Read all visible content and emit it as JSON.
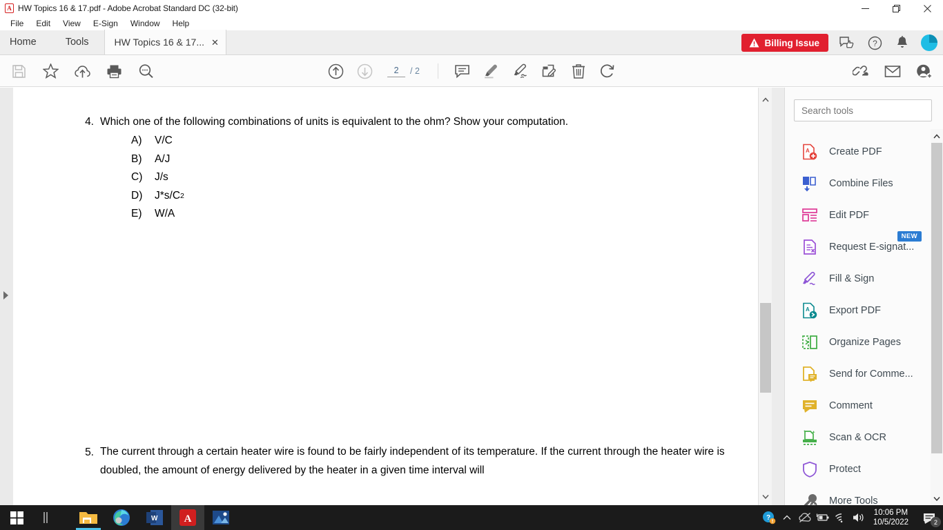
{
  "window": {
    "title": "HW Topics 16 & 17.pdf - Adobe Acrobat Standard DC (32-bit)",
    "app_icon": "acrobat-icon",
    "minimize": "—",
    "restore": "❐",
    "close": "✕"
  },
  "menu": {
    "items": [
      "File",
      "Edit",
      "View",
      "E-Sign",
      "Window",
      "Help"
    ]
  },
  "tabs": {
    "home": "Home",
    "tools": "Tools",
    "document": "HW Topics 16 & 17...",
    "close_glyph": "✕",
    "billing": {
      "label": "Billing Issue",
      "color": "#e1202f",
      "icon": "warning-triangle-icon"
    },
    "right_icons": [
      "feedback-icon",
      "help-icon",
      "bell-icon",
      "avatar"
    ]
  },
  "toolbar": {
    "left_icons": [
      "save-icon",
      "star-icon",
      "cloud-upload-icon",
      "print-icon",
      "search-icon"
    ],
    "center_icons": [
      "page-up-icon",
      "page-down-icon",
      "comment-icon",
      "highlight-icon",
      "sign-icon",
      "stamp-edit-icon",
      "delete-icon",
      "rotate-icon"
    ],
    "right_icons": [
      "share-link-icon",
      "email-icon",
      "add-person-icon"
    ],
    "page_current": "2",
    "page_total": "/ 2"
  },
  "document": {
    "questions": [
      {
        "number": "4.",
        "text": "Which one of the following combinations of units is equivalent to the ohm? Show your computation.",
        "options": [
          {
            "letter": "A)",
            "value": "V/C"
          },
          {
            "letter": "B)",
            "value": "A/J"
          },
          {
            "letter": "C)",
            "value": "J/s"
          },
          {
            "letter": "D)",
            "value": "J*s/C",
            "sup": "2"
          },
          {
            "letter": "E)",
            "value": "W/A"
          }
        ]
      },
      {
        "number": "5.",
        "text": "The current through a certain heater wire is found to be fairly independent of its temperature. If the current through the heater wire is doubled, the amount of energy delivered by the heater in a given time interval will",
        "options": []
      }
    ]
  },
  "tools_panel": {
    "search_placeholder": "Search tools",
    "items": [
      {
        "label": "Create PDF",
        "icon": "create-pdf-icon",
        "color": "#e4443c",
        "badge": null
      },
      {
        "label": "Combine Files",
        "icon": "combine-files-icon",
        "color": "#3b5fd0",
        "badge": null
      },
      {
        "label": "Edit PDF",
        "icon": "edit-pdf-icon",
        "color": "#e0429b",
        "badge": null
      },
      {
        "label": "Request E-signat...",
        "icon": "request-esignature-icon",
        "color": "#9b4fd6",
        "badge": "NEW"
      },
      {
        "label": "Fill & Sign",
        "icon": "fill-sign-icon",
        "color": "#8e56d6",
        "badge": null
      },
      {
        "label": "Export PDF",
        "icon": "export-pdf-icon",
        "color": "#0b8a8f",
        "badge": null
      },
      {
        "label": "Organize Pages",
        "icon": "organize-pages-icon",
        "color": "#46b04a",
        "badge": null
      },
      {
        "label": "Send for Comme...",
        "icon": "send-for-comments-icon",
        "color": "#e0b22a",
        "badge": null
      },
      {
        "label": "Comment",
        "icon": "comment-tool-icon",
        "color": "#e0b22a",
        "badge": null
      },
      {
        "label": "Scan & OCR",
        "icon": "scan-ocr-icon",
        "color": "#46b04a",
        "badge": null
      },
      {
        "label": "Protect",
        "icon": "protect-icon",
        "color": "#8e56d6",
        "badge": null
      },
      {
        "label": "More Tools",
        "icon": "more-tools-icon",
        "color": "#6a6a6a",
        "badge": null
      }
    ]
  },
  "taskbar": {
    "start": "windows-start-icon",
    "task_view": "task-view-icon",
    "apps": [
      "file-explorer-icon",
      "edge-icon",
      "word-icon",
      "acrobat-icon",
      "photos-icon"
    ],
    "tray_icons": [
      "help-warning-icon",
      "chevron-up-icon",
      "onedrive-icon",
      "battery-icon",
      "wifi-icon",
      "volume-icon"
    ],
    "time": "10:06 PM",
    "date": "10/5/2022",
    "notification_count": "2"
  }
}
